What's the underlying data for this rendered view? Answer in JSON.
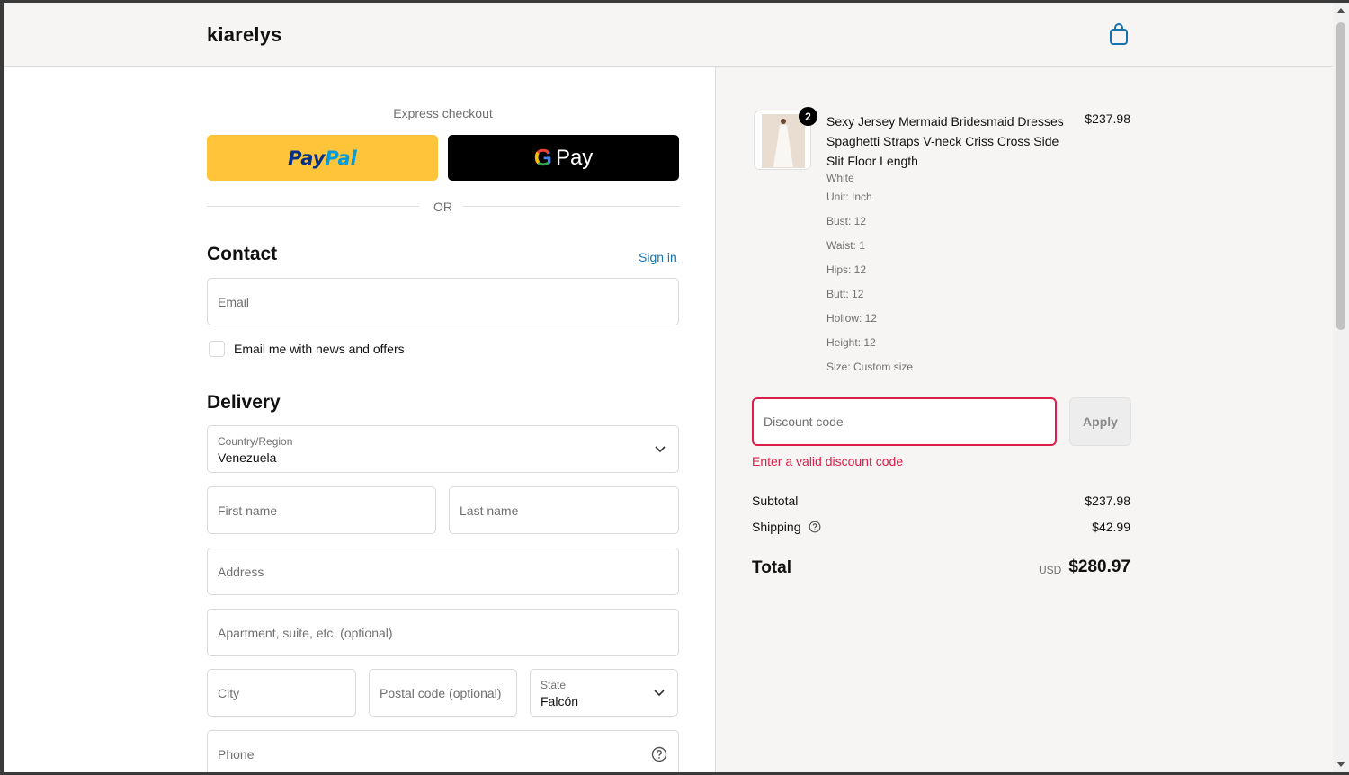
{
  "header": {
    "logo": "kiarelys",
    "cart_icon": "shopping-bag-icon"
  },
  "express": {
    "label": "Express checkout",
    "paypal": {
      "part1": "Pay",
      "part2": "Pal"
    },
    "gpay": {
      "g": "G",
      "label": "Pay"
    },
    "or": "OR"
  },
  "contact": {
    "title": "Contact",
    "signin": "Sign in",
    "email_placeholder": "Email",
    "newsletter_label": "Email me with news and offers"
  },
  "delivery": {
    "title": "Delivery",
    "country_label": "Country/Region",
    "country_value": "Venezuela",
    "first_name": "First name",
    "last_name": "Last name",
    "address": "Address",
    "apartment": "Apartment, suite, etc. (optional)",
    "city": "City",
    "postal": "Postal code (optional)",
    "state_label": "State",
    "state_value": "Falcón",
    "phone": "Phone"
  },
  "summary": {
    "product": {
      "quantity": "2",
      "title": "Sexy Jersey Mermaid Bridesmaid Dresses Spaghetti Straps V-neck Criss Cross Side Slit Floor Length",
      "price": "$237.98",
      "variant": "White",
      "details": [
        "Unit: Inch",
        "Bust: 12",
        "Waist: 1",
        "Hips: 12",
        "Butt: 12",
        "Hollow: 12",
        "Height: 12",
        "Size: Custom size"
      ]
    },
    "discount_placeholder": "Discount code",
    "apply": "Apply",
    "error": "Enter a valid discount code",
    "subtotal_label": "Subtotal",
    "subtotal_value": "$237.98",
    "shipping_label": "Shipping",
    "shipping_value": "$42.99",
    "total_label": "Total",
    "currency": "USD",
    "total_value": "$280.97"
  },
  "colors": {
    "paypal": "#ffc439",
    "gpay": "#000000",
    "error": "#dd1d4a",
    "link": "#1773b0",
    "summary_bg": "#f7f5f3"
  }
}
